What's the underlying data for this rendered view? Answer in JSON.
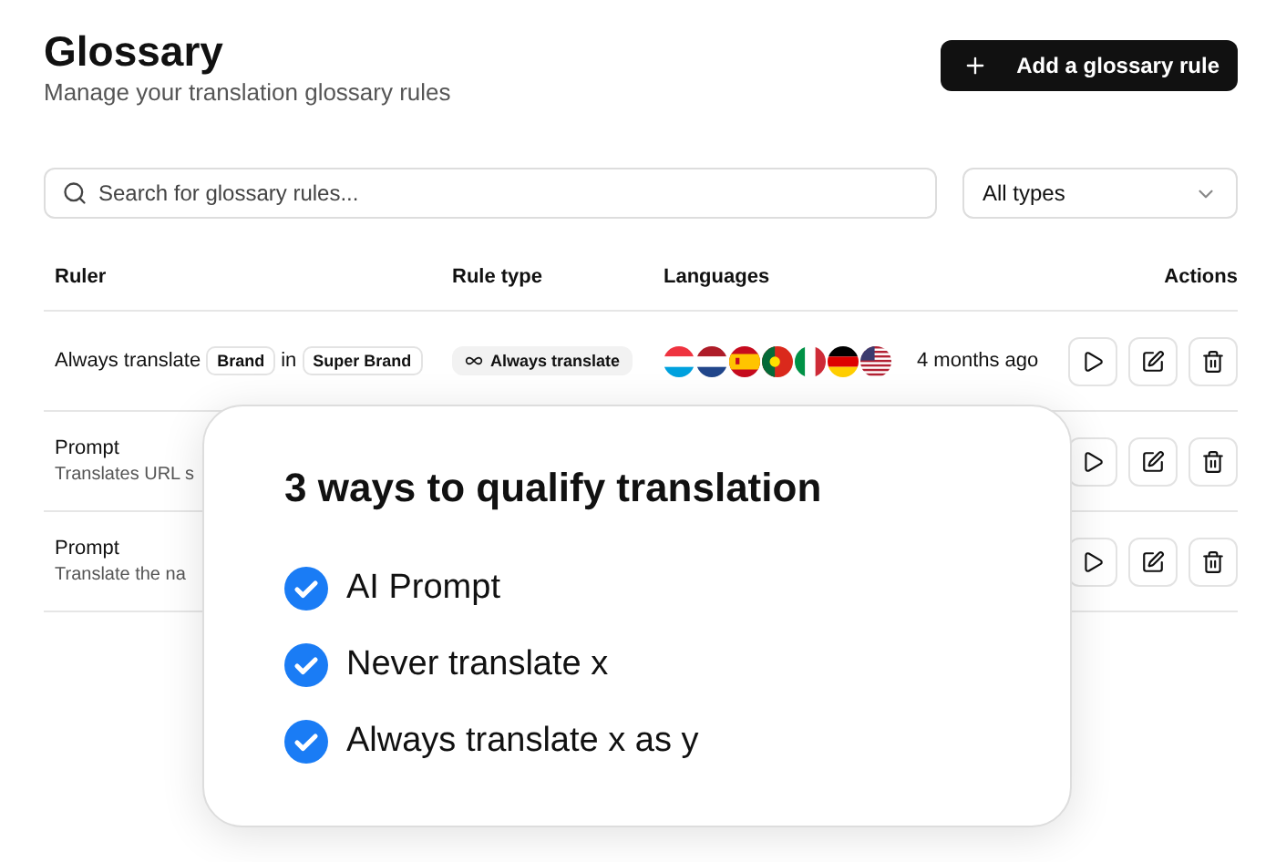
{
  "header": {
    "title": "Glossary",
    "subtitle": "Manage your translation glossary rules",
    "add_button": "Add a glossary rule"
  },
  "search": {
    "placeholder": "Search for glossary rules..."
  },
  "type_filter": {
    "value": "All types"
  },
  "table": {
    "columns": [
      "Ruler",
      "Rule type",
      "Languages",
      "Actions"
    ],
    "rows": [
      {
        "kind": "rule",
        "ruler": [
          {
            "kind": "text",
            "text": "Always translate"
          },
          {
            "kind": "tag",
            "text": "Brand"
          },
          {
            "kind": "text",
            "text": "in"
          },
          {
            "kind": "tag",
            "text": "Super Brand"
          }
        ],
        "rule_type": "Always translate",
        "updated": "4 months ago"
      },
      {
        "kind": "prompt",
        "title": "Prompt",
        "description": "Translates URL s"
      },
      {
        "kind": "prompt",
        "title": "Prompt",
        "description": "Translate the na"
      }
    ]
  },
  "overlay": {
    "title": "3 ways to qualify translation",
    "items": [
      "AI Prompt",
      "Never translate x",
      "Always translate x as y"
    ]
  }
}
